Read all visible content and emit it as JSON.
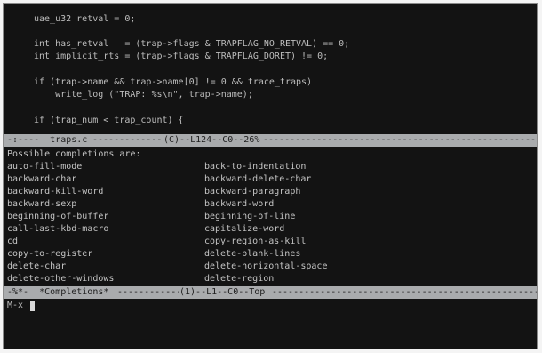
{
  "code_lines": [
    "uae_u32 retval = 0;",
    "int has_retval   = (trap->flags & TRAPFLAG_NO_RETVAL) == 0;",
    "int implicit_rts = (trap->flags & TRAPFLAG_DORET) != 0;",
    "if (trap->name && trap->name[0] != 0 && trace_traps)",
    "    write_log (\"TRAP: %s\\n\", trap->name);",
    "if (trap_num < trap_count) {"
  ],
  "upper_modeline": {
    "left": "-:----  traps.c",
    "position": "(C)--L124--C0--26%"
  },
  "completions": {
    "header": "Possible completions are:",
    "left_column": [
      "auto-fill-mode",
      "backward-char",
      "backward-kill-word",
      "backward-sexp",
      "beginning-of-buffer",
      "call-last-kbd-macro",
      "cd",
      "copy-to-register",
      "delete-char",
      "delete-other-windows"
    ],
    "right_column": [
      "back-to-indentation",
      "backward-delete-char",
      "backward-paragraph",
      "backward-word",
      "beginning-of-line",
      "capitalize-word",
      "copy-region-as-kill",
      "delete-blank-lines",
      "delete-horizontal-space",
      "delete-region"
    ]
  },
  "lower_modeline": {
    "left": "-%*-  *Completions*",
    "position": "(1)--L1--C0--Top"
  },
  "minibuffer": {
    "prompt": "M-x "
  },
  "colors": {
    "background": "#131313",
    "text": "#bdbdbd",
    "modeline_bg": "#a9abad",
    "modeline_fg": "#1e1e1e"
  }
}
